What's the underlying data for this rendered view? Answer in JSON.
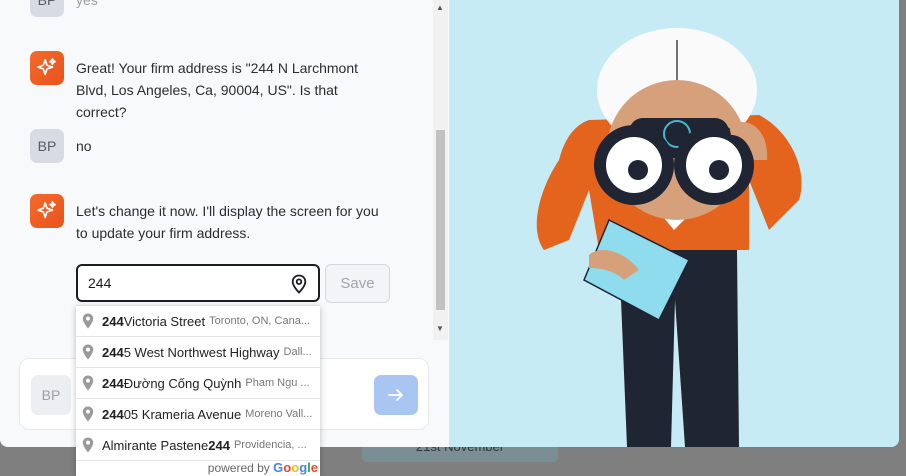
{
  "backdrop": {
    "date_label": "21st November"
  },
  "chat": {
    "messages": [
      {
        "sender": "user",
        "avatar": "BP",
        "text": "yes"
      },
      {
        "sender": "bot",
        "text": "Great! Your firm address is \"244 N Larchmont Blvd, Los Angeles, Ca, 90004, US\". Is that correct?"
      },
      {
        "sender": "user",
        "avatar": "BP",
        "text": "no"
      },
      {
        "sender": "bot",
        "text": "Let's change it now. I'll display the screen for you to update your firm address."
      }
    ],
    "address_input": {
      "value": "244",
      "icon": "map-pin-icon"
    },
    "save_label": "Save",
    "composer": {
      "avatar": "BP",
      "send_icon": "arrow-right-icon"
    }
  },
  "suggestions": [
    {
      "match": "244",
      "rest": " Victoria Street",
      "secondary": "Toronto, ON, Cana..."
    },
    {
      "match": "244",
      "rest": "5 West Northwest Highway",
      "secondary": "Dall..."
    },
    {
      "match": "244",
      "rest": " Đường Cống Quỳnh",
      "secondary": "Pham Ngu ..."
    },
    {
      "match": "244",
      "rest": "05 Krameria Avenue",
      "secondary": "Moreno Vall..."
    },
    {
      "prefix": "Almirante Pastene ",
      "match": "244",
      "rest": "",
      "secondary": "Providencia, ..."
    }
  ],
  "powered_by": {
    "text": "powered by",
    "brand": "Google"
  },
  "colors": {
    "accent": "#f36a2b",
    "send_button": "#a9c6f3",
    "illustration_bg": "#c7ebf4"
  }
}
